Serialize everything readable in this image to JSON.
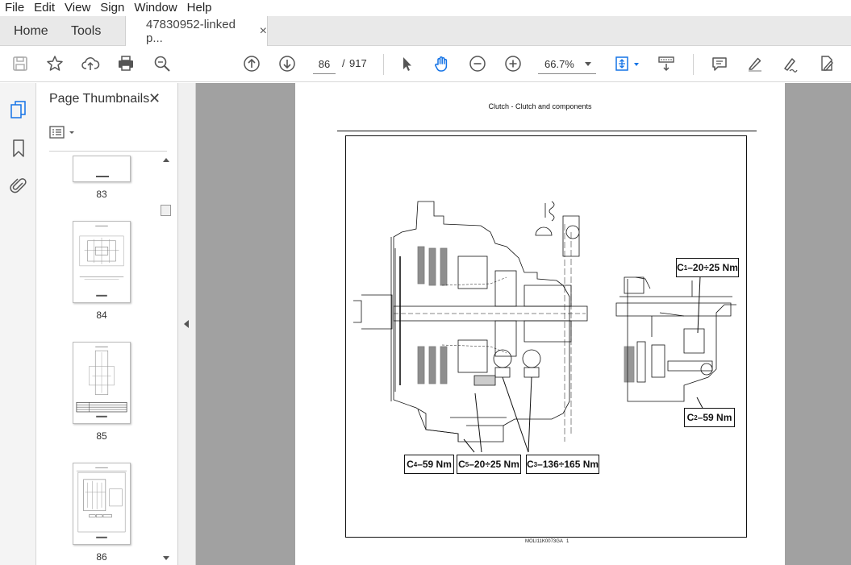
{
  "menu": [
    "File",
    "Edit",
    "View",
    "Sign",
    "Window",
    "Help"
  ],
  "tabs": {
    "home": "Home",
    "tools": "Tools",
    "document": "47830952-linked p...",
    "close": "×"
  },
  "toolbar": {
    "page_current": "86",
    "page_sep": "/",
    "page_total": "917",
    "zoom": "66.7%"
  },
  "thumbnails": {
    "title": "Page Thumbnails",
    "close": "✕",
    "pages": [
      "83",
      "84",
      "85",
      "86"
    ]
  },
  "document": {
    "header": "Clutch - Clutch and components",
    "footer_code": "MOLI11K0073GA",
    "footer_num": "1",
    "callouts": {
      "c1": {
        "letter": "C",
        "sub": "1",
        "value": "–20÷25 Nm"
      },
      "c2": {
        "letter": "C",
        "sub": "2",
        "value": "–59 Nm"
      },
      "c3": {
        "letter": "C",
        "sub": "3",
        "value": "–136÷165 Nm"
      },
      "c4": {
        "letter": "C",
        "sub": "4",
        "value": "–59 Nm"
      },
      "c5": {
        "letter": "C",
        "sub": "5",
        "value": "–20÷25 Nm"
      }
    }
  },
  "colors": {
    "accent_blue": "#1473e6",
    "viewer_bg": "#a1a1a1",
    "tab_bg": "#e9e9e9"
  }
}
